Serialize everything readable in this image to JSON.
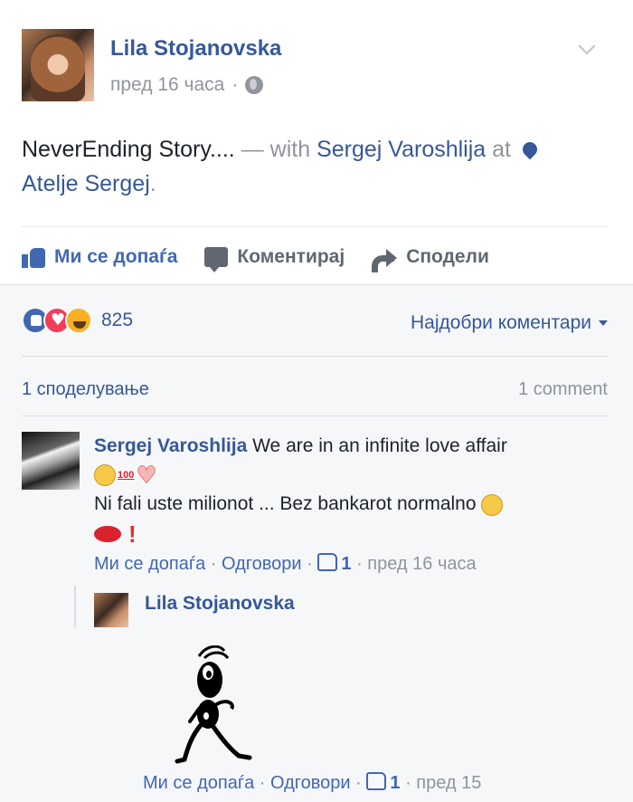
{
  "post": {
    "author": "Lila Stojanovska",
    "time": "пред 16 часа",
    "separator": "·",
    "text_main": "NeverEnding Story....",
    "text_with": " — with ",
    "tagged_person": "Sergej Varoshlija",
    "text_at": " at ",
    "place": "Atelje Sergej",
    "text_end": ".",
    "privacy_icon": "globe-icon"
  },
  "actions": {
    "like": "Ми се допаѓа",
    "comment": "Коментирај",
    "share": "Сподели"
  },
  "summary": {
    "reaction_count": "825",
    "reactions": [
      "like",
      "love",
      "haha"
    ],
    "sort_label": "Најдобри коментари",
    "shares": "1 споделување",
    "comments": "1 comment"
  },
  "comment": {
    "author": "Sergej Varoshlija",
    "text1": "We are in an infinite love affair",
    "text2": "Ni fali uste milionot ... Bez bankarot normalno",
    "like": "Ми се допаѓа",
    "reply": "Одговори",
    "likes": "1",
    "time": "пред 16 часа",
    "dot": " · "
  },
  "reply": {
    "author": "Lila Stojanovska",
    "like": "Ми се допаѓа",
    "reply": "Одговори",
    "likes": "1",
    "time": "пред 15",
    "dot": " · "
  },
  "colors": {
    "link": "#365899",
    "accent": "#4267b2",
    "muted": "#90949c",
    "bg_comments": "#f6f7f9"
  }
}
